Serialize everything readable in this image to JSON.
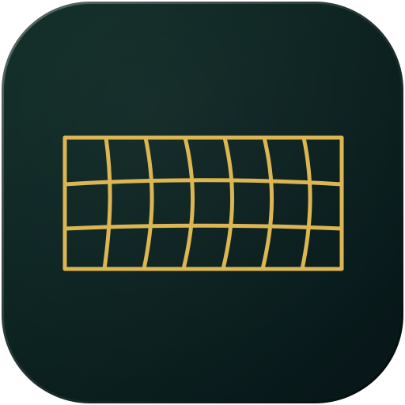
{
  "icon": {
    "name": "warped-grid-app-icon",
    "glyph": "warp-grid-icon",
    "colors": {
      "background_top": "#0d2a24",
      "background_bottom": "#071619",
      "edge_highlight": "#5d6f6a",
      "edge_shadow": "#03090a",
      "grid_stroke": "#dcb653"
    }
  }
}
